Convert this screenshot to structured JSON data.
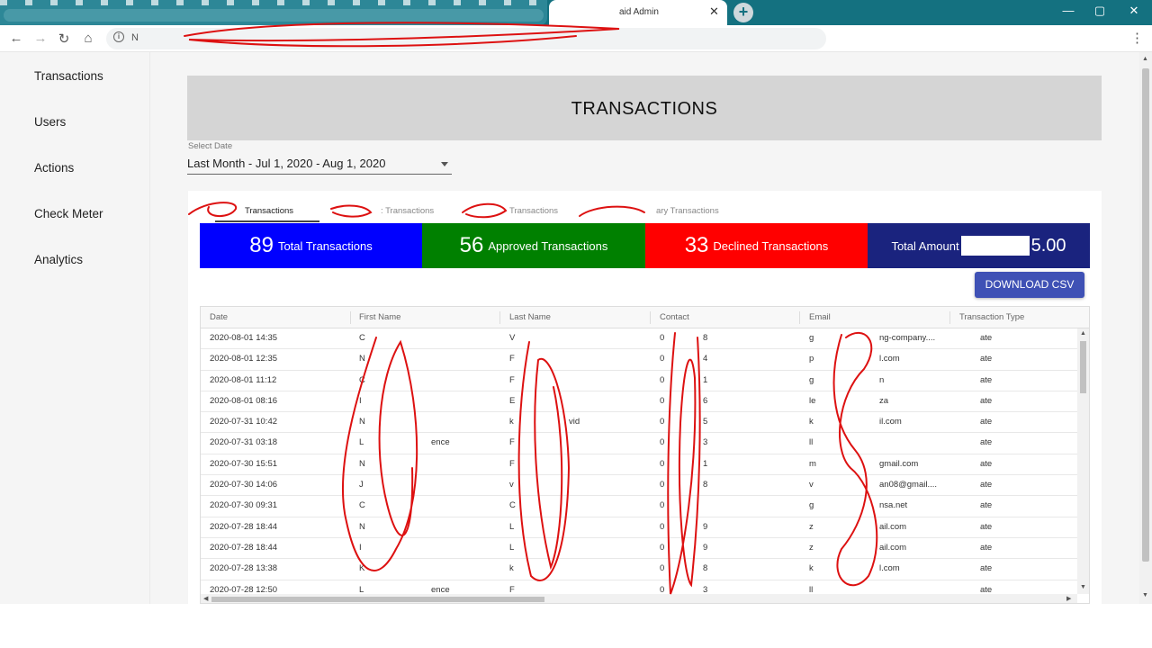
{
  "browser": {
    "tab_title": "aid Admin",
    "tab_close": "✕",
    "new_tab": "+",
    "url_prefix": "N",
    "minimize": "—",
    "maximize": "▢",
    "close": "✕",
    "back": "←",
    "forward": "→",
    "reload": "↻",
    "home": "⌂",
    "menu": "⋮"
  },
  "sidebar": {
    "items": [
      {
        "label": "Transactions"
      },
      {
        "label": "Users"
      },
      {
        "label": "Actions"
      },
      {
        "label": "Check Meter"
      },
      {
        "label": "Analytics"
      }
    ]
  },
  "header": {
    "title": "TRANSACTIONS"
  },
  "date_filter": {
    "label": "Select Date",
    "value": "Last Month - Jul 1, 2020 - Aug 1, 2020"
  },
  "tabs": [
    {
      "label": "Transactions",
      "active": true
    },
    {
      "label": ": Transactions",
      "active": false
    },
    {
      "label": "Transactions",
      "active": false
    },
    {
      "label": "ary Transactions",
      "active": false
    }
  ],
  "stats": [
    {
      "value": "89",
      "label": "Total Transactions",
      "color": "#0000ff"
    },
    {
      "value": "56",
      "label": "Approved Transactions",
      "color": "#008000"
    },
    {
      "value": "33",
      "label": "Declined Transactions",
      "color": "#ff0000"
    },
    {
      "label": "Total Amount",
      "amount": "5.00",
      "color": "#1a237e"
    }
  ],
  "download_button": "DOWNLOAD CSV",
  "table": {
    "columns": [
      "Date",
      "First Name",
      "Last Name",
      "Contact",
      "Email",
      "Transaction Type"
    ],
    "rows": [
      {
        "date": "2020-08-01 14:35",
        "first": "C",
        "last": "V",
        "contact": "0",
        "contact_end": "8",
        "email": "g",
        "email_end": "ng-company....",
        "type": "ate"
      },
      {
        "date": "2020-08-01 12:35",
        "first": "N",
        "last": "F",
        "contact": "0",
        "contact_end": "4",
        "email": "p",
        "email_end": "l.com",
        "type": "ate"
      },
      {
        "date": "2020-08-01 11:12",
        "first": "C",
        "last": "F",
        "contact": "0",
        "contact_end": "1",
        "email": "g",
        "email_end": "n",
        "type": "ate"
      },
      {
        "date": "2020-08-01 08:16",
        "first": "I",
        "last": "E",
        "contact": "0",
        "contact_end": "6",
        "email": "le",
        "email_end": "za",
        "type": "ate"
      },
      {
        "date": "2020-07-31 10:42",
        "first": "N",
        "last": "k",
        "last_end": "vid",
        "contact": "0",
        "contact_end": "5",
        "email": "k",
        "email_end": "il.com",
        "type": "ate"
      },
      {
        "date": "2020-07-31 03:18",
        "first": "L",
        "first_end": "ence",
        "last": "F",
        "contact": "0",
        "contact_end": "3",
        "email": "ll",
        "email_end": "",
        "type": "ate"
      },
      {
        "date": "2020-07-30 15:51",
        "first": "N",
        "last": "F",
        "contact": "0",
        "contact_end": "1",
        "email": "m",
        "email_end": "gmail.com",
        "type": "ate"
      },
      {
        "date": "2020-07-30 14:06",
        "first": "J",
        "last": "v",
        "contact": "0",
        "contact_end": "8",
        "email": "v",
        "email_end": "an08@gmail....",
        "type": "ate"
      },
      {
        "date": "2020-07-30 09:31",
        "first": "C",
        "last": "C",
        "contact": "0",
        "contact_end": "",
        "email": "g",
        "email_end": "nsa.net",
        "type": "ate"
      },
      {
        "date": "2020-07-28 18:44",
        "first": "N",
        "last": "L",
        "contact": "0",
        "contact_end": "9",
        "email": "z",
        "email_end": "ail.com",
        "type": "ate"
      },
      {
        "date": "2020-07-28 18:44",
        "first": "I",
        "last": "L",
        "contact": "0",
        "contact_end": "9",
        "email": "z",
        "email_end": "ail.com",
        "type": "ate"
      },
      {
        "date": "2020-07-28 13:38",
        "first": "K",
        "last": "k",
        "contact": "0",
        "contact_end": "8",
        "email": "k",
        "email_end": "l.com",
        "type": "ate"
      },
      {
        "date": "2020-07-28 12:50",
        "first": "L",
        "first_end": "ence",
        "last": "F",
        "contact": "0",
        "contact_end": "3",
        "email": "ll",
        "email_end": "",
        "type": "ate"
      }
    ]
  },
  "colors": {
    "chrome_teal": "#147180",
    "sidebar_bg": "#f5f5f5",
    "title_bg": "#d5d5d5",
    "button_indigo": "#3f51b5",
    "redaction_red": "#dd1111"
  }
}
